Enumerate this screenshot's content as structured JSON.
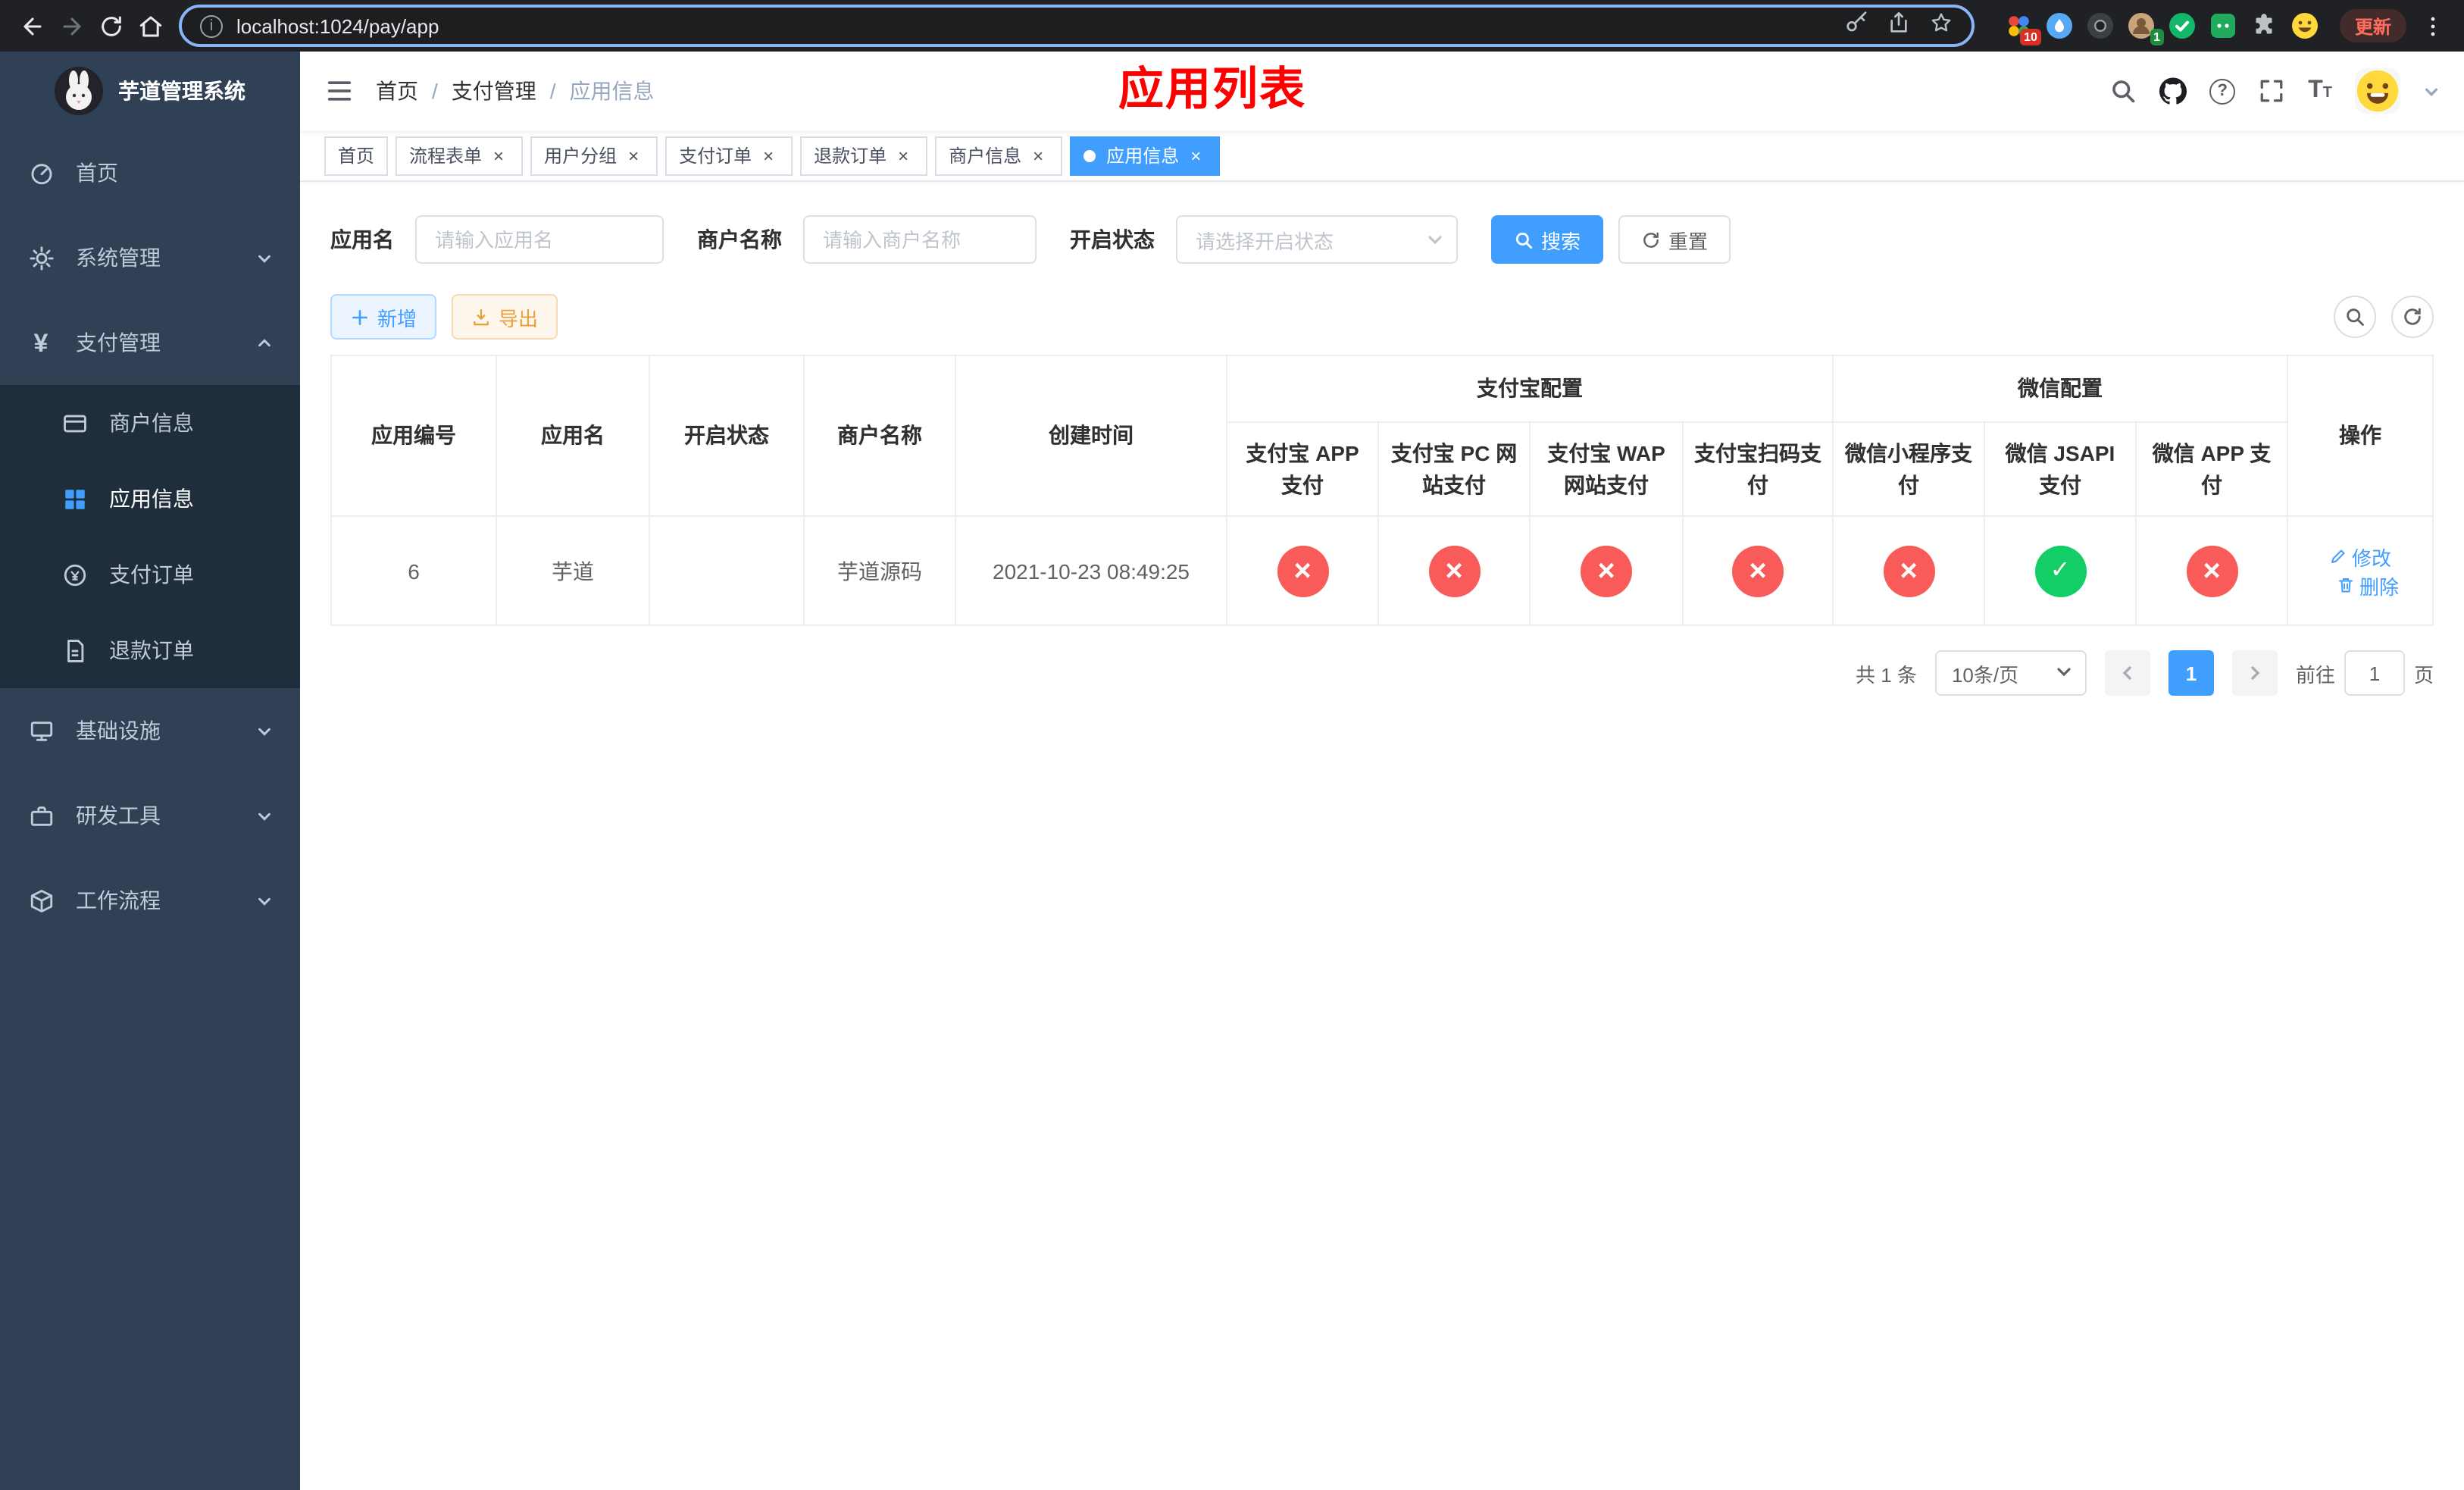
{
  "browser": {
    "url": "localhost:1024/pay/app",
    "update_label": "更新",
    "extension_badge_red": "10",
    "extension_badge_green": "1"
  },
  "sidebar": {
    "title": "芋道管理系统",
    "items": [
      {
        "label": "首页"
      },
      {
        "label": "系统管理"
      },
      {
        "label": "支付管理",
        "children": [
          {
            "label": "商户信息"
          },
          {
            "label": "应用信息"
          },
          {
            "label": "支付订单"
          },
          {
            "label": "退款订单"
          }
        ]
      },
      {
        "label": "基础设施"
      },
      {
        "label": "研发工具"
      },
      {
        "label": "工作流程"
      }
    ]
  },
  "header": {
    "breadcrumb": [
      "首页",
      "支付管理",
      "应用信息"
    ],
    "annotation": "应用列表"
  },
  "tabs": [
    {
      "label": "首页"
    },
    {
      "label": "流程表单"
    },
    {
      "label": "用户分组"
    },
    {
      "label": "支付订单"
    },
    {
      "label": "退款订单"
    },
    {
      "label": "商户信息"
    },
    {
      "label": "应用信息"
    }
  ],
  "filters": {
    "app_name_label": "应用名",
    "app_name_placeholder": "请输入应用名",
    "merchant_label": "商户名称",
    "merchant_placeholder": "请输入商户名称",
    "status_label": "开启状态",
    "status_placeholder": "请选择开启状态",
    "search_label": "搜索",
    "reset_label": "重置"
  },
  "toolbar": {
    "add_label": "新增",
    "export_label": "导出"
  },
  "table": {
    "columns": {
      "id": "应用编号",
      "name": "应用名",
      "status": "开启状态",
      "merchant": "商户名称",
      "created": "创建时间",
      "alipay_group": "支付宝配置",
      "alipay_app": "支付宝 APP 支付",
      "alipay_pc": "支付宝 PC 网站支付",
      "alipay_wap": "支付宝 WAP 网站支付",
      "alipay_qr": "支付宝扫码支付",
      "wechat_group": "微信配置",
      "wechat_mini": "微信小程序支付",
      "wechat_jsapi": "微信 JSAPI 支付",
      "wechat_app": "微信 APP 支付",
      "actions": "操作"
    },
    "rows": [
      {
        "id": "6",
        "name": "芋道",
        "enabled": true,
        "merchant": "芋道源码",
        "created": "2021-10-23 08:49:25",
        "configs": [
          false,
          false,
          false,
          false,
          false,
          true,
          false
        ],
        "edit_label": "修改",
        "delete_label": "删除"
      }
    ]
  },
  "pagination": {
    "total": "共 1 条",
    "page_size": "10条/页",
    "page": "1",
    "goto_label": "前往",
    "goto_value": "1",
    "unit": "页"
  },
  "colors": {
    "primary": "#409eff",
    "danger": "#f95b5b",
    "success": "#13ce66",
    "warning": "#e6a23c",
    "annotation": "#ff0000",
    "sidebar_bg": "#304156",
    "submenu_bg": "#1f2d3d"
  }
}
